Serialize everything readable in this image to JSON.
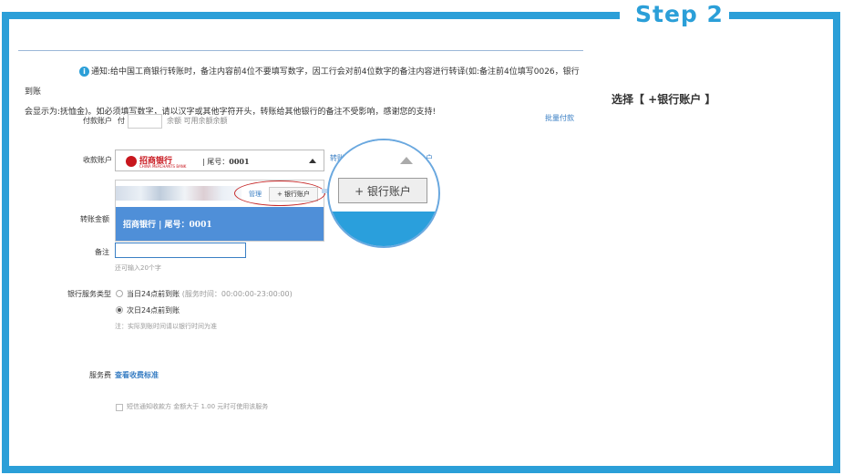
{
  "step": {
    "label": "Step 2"
  },
  "instruction": "选择【 +银行账户 】",
  "notice": {
    "line1": "通知:给中国工商银行转账时，备注内容前4位不要填写数字，因工行会对前4位数字的备注内容进行转译(如:备注前4位填写0026，银行到账",
    "line2": "会显示为:抚恤金)。如必须填写数字，请以汉字或其他字符开头，转账给其他银行的备注不受影响，感谢您的支持!"
  },
  "form": {
    "payer_label": "付款账户",
    "payer_prefix": "付",
    "payer_hint": "余额 可用余额余额",
    "batch_link": "批量付款",
    "payee_label": "收款账户",
    "bank_name": "招商银行",
    "bank_sub": "CHINA MERCHANTS BANK",
    "tail_label": "尾号：",
    "tail_number": "0001",
    "payee_link_left": "转账",
    "payee_link_right": "户",
    "manage_link": "管理",
    "add_bank_small": "+ 银行账户",
    "dropdown_bank_row": "招商银行 | 尾号：0001",
    "amount_label": "转账金额",
    "memo_label": "备注",
    "memo_hint": "还可输入20个字",
    "service_type_label": "银行服务类型",
    "option1": "当日24点前到账",
    "option1_note": "(服务时间：00:00:00-23:00:00)",
    "option2": "次日24点前到账",
    "arrival_note": "注：实际到账时间请以银行时间为准",
    "fee_label": "服务费",
    "fee_link": "查看收费标准",
    "sms_label": "短信通知收款方",
    "sms_note": "金额大于 1.00 元时可使用该服务"
  },
  "magnifier": {
    "button_label": "+ 银行账户"
  },
  "colors": {
    "accent": "#2b9fd8",
    "link": "#3a7fc4",
    "highlight_row": "#4f8fd8",
    "annotation": "#c62828"
  }
}
